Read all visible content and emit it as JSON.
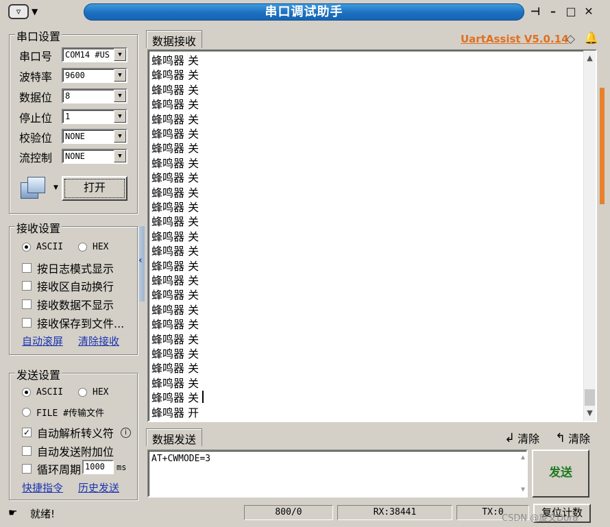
{
  "window": {
    "title": "串口调试助手",
    "app_version": "UartAssist V5.0.14"
  },
  "serial_settings": {
    "title": "串口设置",
    "port": {
      "label": "串口号",
      "value": "COM14 #US"
    },
    "baud": {
      "label": "波特率",
      "value": "9600"
    },
    "databits": {
      "label": "数据位",
      "value": "8"
    },
    "stopbits": {
      "label": "停止位",
      "value": "1"
    },
    "parity": {
      "label": "校验位",
      "value": "NONE"
    },
    "flow": {
      "label": "流控制",
      "value": "NONE"
    },
    "open_button": "打开"
  },
  "receive_settings": {
    "title": "接收设置",
    "ascii": "ASCII",
    "hex": "HEX",
    "opt_log_mode": "按日志模式显示",
    "opt_auto_wrap": "接收区自动换行",
    "opt_hide_data": "接收数据不显示",
    "opt_save_file": "接收保存到文件...",
    "link_auto_scroll": "自动滚屏",
    "link_clear_receive": "清除接收"
  },
  "send_settings": {
    "title": "发送设置",
    "ascii": "ASCII",
    "hex": "HEX",
    "file": "FILE #传输文件",
    "opt_escape": "自动解析转义符",
    "opt_append_bit": "自动发送附加位",
    "opt_cycle": "循环周期",
    "cycle_value": "1000",
    "cycle_unit": "ms",
    "link_shortcut": "快捷指令",
    "link_history": "历史发送"
  },
  "receive_panel": {
    "tab": "数据接收",
    "lines": [
      "蜂鸣器 关",
      "蜂鸣器 关",
      "蜂鸣器 关",
      "蜂鸣器 关",
      "蜂鸣器 关",
      "蜂鸣器 关",
      "蜂鸣器 关",
      "蜂鸣器 关",
      "蜂鸣器 关",
      "蜂鸣器 关",
      "蜂鸣器 关",
      "蜂鸣器 关",
      "蜂鸣器 关",
      "蜂鸣器 关",
      "蜂鸣器 关",
      "蜂鸣器 关",
      "蜂鸣器 关",
      "蜂鸣器 关",
      "蜂鸣器 关",
      "蜂鸣器 关",
      "蜂鸣器 关",
      "蜂鸣器 关",
      "蜂鸣器 关",
      "蜂鸣器 关",
      "蜂鸣器 开"
    ]
  },
  "send_panel": {
    "tab": "数据发送",
    "clear1": "清除",
    "clear2": "清除",
    "input_value": "AT+CWMODE=3",
    "send_button": "发送"
  },
  "status_bar": {
    "state": "就绪!",
    "counter": "800/0",
    "rx": "RX:38441",
    "tx": "TX:0",
    "reset_button": "复位计数",
    "watermark": "CSDN @旋文Dora"
  },
  "colors": {
    "title_bar": "#1d6fbf",
    "version_link": "#e07020",
    "link": "#1a33b0",
    "send_button_text": "#1f7a1f"
  }
}
